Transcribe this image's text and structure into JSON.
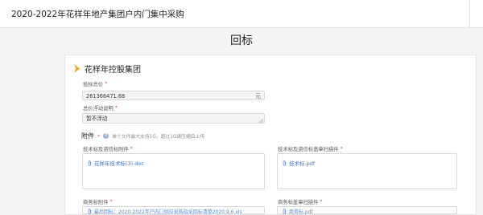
{
  "window": {
    "title": "2020-2022年花样年地产集团户内门集中采购"
  },
  "page": {
    "heading": "回标"
  },
  "company": {
    "name": "花样年控股集团",
    "accent": "#f0a21b"
  },
  "form": {
    "bid_total": {
      "label": "投标总价",
      "required_mark": "*",
      "value": "261366471.68",
      "unit": "元"
    },
    "price_float": {
      "label": "总价浮动说明",
      "required_mark": "*",
      "value": "暂不浮动"
    }
  },
  "attachments": {
    "title": "附件",
    "required_mark": "*",
    "hint": "单个文件最大支持1G，超过1G请压缩后上传",
    "tech_bid": {
      "label": "技术标及资信标附件",
      "required_mark": "*",
      "file": "花样年技术标(3).doc"
    },
    "tech_scan": {
      "label": "技术标及资信标盖章扫描件",
      "required_mark": "*",
      "file": "技术标.pdf"
    },
    "commercial_bid": {
      "label": "商务标附件",
      "required_mark": "*",
      "file": "最后回标：2020-2022年户内门供应采购战采回标清单2020.9.6.xls"
    },
    "commercial_scan": {
      "label": "商务标盖章扫描件",
      "required_mark": "*",
      "file": "商务标.pdf"
    }
  }
}
